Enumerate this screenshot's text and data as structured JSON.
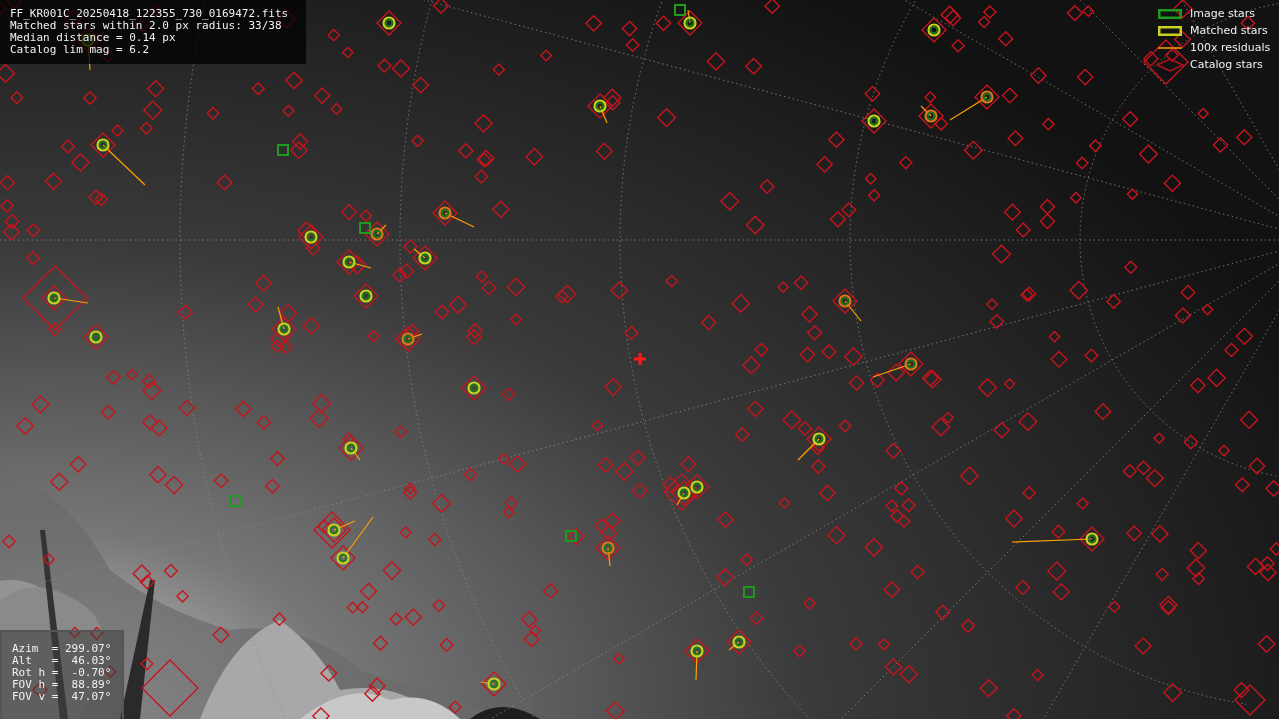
{
  "info": {
    "lines": [
      "FF_KR001C_20250418_122355_730_0169472.fits",
      "Matched stars within 2.0 px radius: 33/38",
      "Median distance = 0.14 px",
      "Catalog lim mag = 6.2"
    ]
  },
  "legend": [
    {
      "label": "Image stars"
    },
    {
      "kind": "matched",
      "label": "Matched stars"
    },
    {
      "kind": "residual",
      "label": "100x residuals"
    },
    {
      "kind": "catalog",
      "label": "Catalog stars"
    }
  ],
  "pointing": {
    "lines": [
      "Azim  = 299.07°",
      "Alt   =  46.03°",
      "Rot h =  -0.70°",
      "FOV h =  88.89°",
      "FOV v =  47.07°"
    ]
  }
}
